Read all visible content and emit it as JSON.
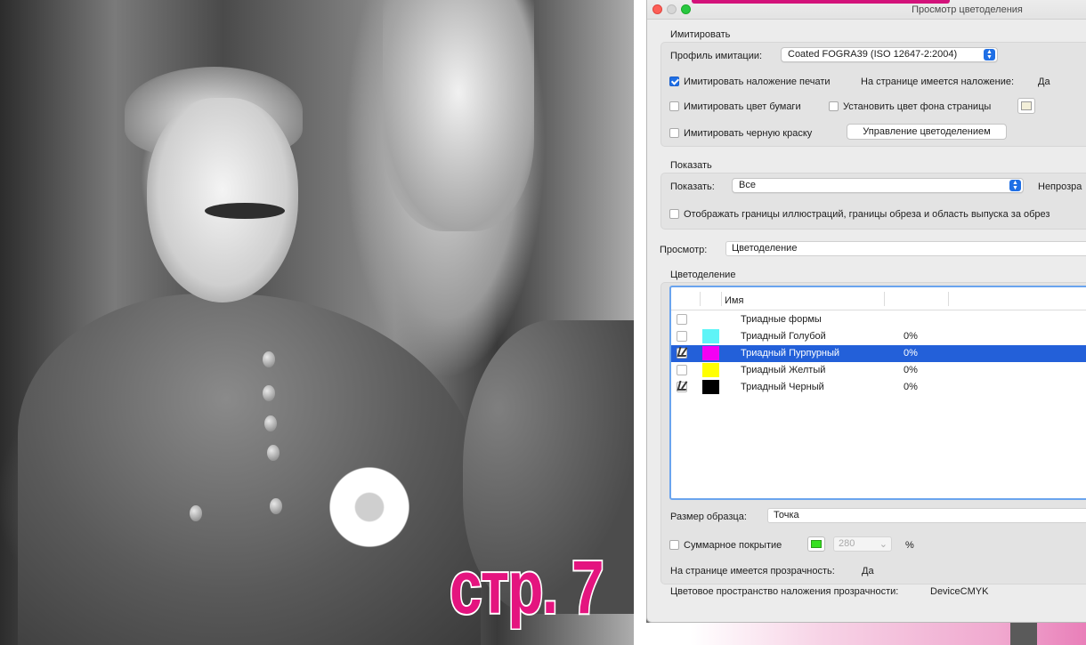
{
  "background": {
    "page_label": "стр. 7"
  },
  "window": {
    "title": "Просмотр цветоделения",
    "simulate": {
      "section_label": "Имитировать",
      "profile_label": "Профиль имитации:",
      "profile_value": "Coated FOGRA39 (ISO 12647-2:2004)",
      "overprint_label": "Имитировать наложение печати",
      "overprint_checked": true,
      "page_has_overprint_label": "На странице имеется наложение:",
      "page_has_overprint_value": "Да",
      "paper_color_label": "Имитировать цвет бумаги",
      "paper_color_checked": false,
      "bg_color_label": "Установить цвет фона страницы",
      "bg_color_checked": false,
      "black_ink_label": "Имитировать черную краску",
      "black_ink_checked": false,
      "manage_button": "Управление цветоделением"
    },
    "show": {
      "section_label": "Показать",
      "show_label": "Показать:",
      "show_value": "Все",
      "opacity_label": "Непрозра",
      "boundaries_label": "Отображать границы иллюстраций, границы обреза и область выпуска за обрез",
      "boundaries_checked": false
    },
    "preview": {
      "label": "Просмотр:",
      "value": "Цветоделение"
    },
    "separations": {
      "section_label": "Цветоделение",
      "column_name": "Имя",
      "rows": [
        {
          "name": "Триадные формы",
          "pct": "",
          "color": "",
          "visible": false,
          "selected": false
        },
        {
          "name": "Триадный Голубой",
          "pct": "0%",
          "color": "#5ef4f7",
          "visible": false,
          "selected": false
        },
        {
          "name": "Триадный Пурпурный",
          "pct": "0%",
          "color": "#f400f4",
          "visible": true,
          "selected": true
        },
        {
          "name": "Триадный Желтый",
          "pct": "0%",
          "color": "#ffff00",
          "visible": false,
          "selected": false
        },
        {
          "name": "Триадный Черный",
          "pct": "0%",
          "color": "#000000",
          "visible": true,
          "selected": false
        }
      ]
    },
    "sample": {
      "label": "Размер образца:",
      "value": "Точка"
    },
    "coverage": {
      "label": "Суммарное покрытие",
      "checked": false,
      "swatch_color": "#35e01f",
      "value": "280",
      "unit": "%"
    },
    "transparency": {
      "label": "На странице имеется прозрачность:",
      "value": "Да",
      "space_label": "Цветовое пространство наложения прозрачности:",
      "space_value": "DeviceCMYK"
    }
  }
}
